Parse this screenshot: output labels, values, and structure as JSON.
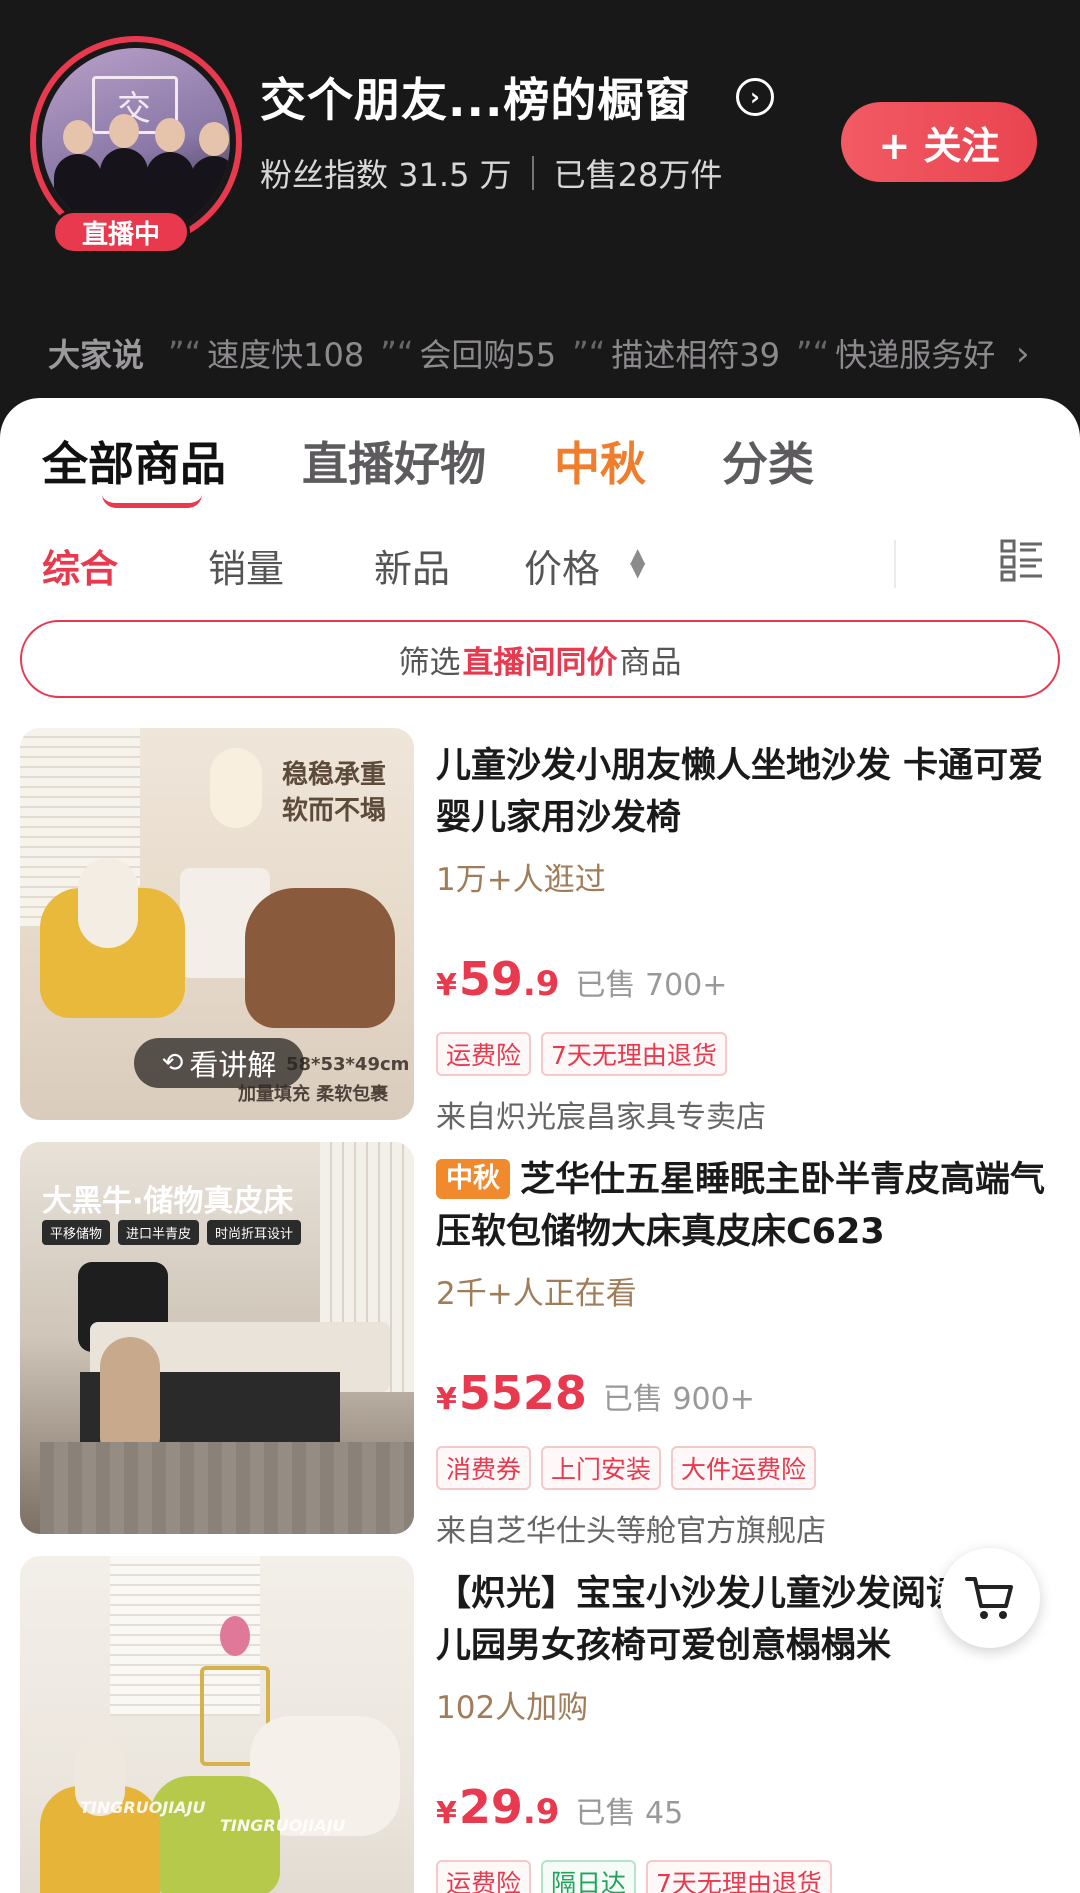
{
  "header": {
    "live_badge": "直播中",
    "shop_name": "交个朋友...榜的橱窗",
    "fans_text": "粉丝指数 31.5 万",
    "sold_text": "已售28万件",
    "follow_label": "+ 关注",
    "avatar_logo_text": "交"
  },
  "reviews": {
    "label": "大家说",
    "chips": [
      "速度快108",
      "会回购55",
      "描述相符39",
      "快递服务好"
    ]
  },
  "tabs": [
    "全部商品",
    "直播好物",
    "中秋",
    "分类"
  ],
  "sorts": [
    "综合",
    "销量",
    "新品",
    "价格"
  ],
  "filter": {
    "prefix": "筛选",
    "highlight": "直播间同价",
    "suffix": "商品"
  },
  "products": [
    {
      "title": "儿童沙发小朋友懒人坐地沙发 卡通可爱 婴儿家用沙发椅",
      "hot": "1万+人逛过",
      "currency": "¥",
      "price_int": "59",
      "price_dec": ".9",
      "sold": "已售 700+",
      "tags": [
        "运费险",
        "7天无理由退货"
      ],
      "store": "来自炽光宸昌家具专卖店",
      "img_text_1": "稳稳承重",
      "img_text_2": "软而不塌",
      "img_size": "58*53*49cm",
      "img_caption": "加量填充 柔软包裹",
      "watch_label": "看讲解"
    },
    {
      "title_tag": "中秋",
      "title": "芝华仕五星睡眠主卧半青皮高端气压软包储物大床真皮床C623",
      "hot": "2千+人正在看",
      "currency": "¥",
      "price_int": "5528",
      "price_dec": "",
      "sold": "已售 900+",
      "tags": [
        "消费券",
        "上门安装",
        "大件运费险"
      ],
      "store": "来自芝华仕头等舱官方旗舰店",
      "img_title": "大黑牛·储物真皮床",
      "img_badges": [
        "平移储物",
        "进口半青皮",
        "时尚折耳设计"
      ]
    },
    {
      "title": "【炽光】宝宝小沙发儿童沙发阅读角幼儿园男女孩椅可爱创意榻榻米",
      "hot": "102人加购",
      "currency": "¥",
      "price_int": "29",
      "price_dec": ".9",
      "sold": "已售 45",
      "tags": [
        "运费险",
        "隔日达",
        "7天无理由退货"
      ],
      "tag_colors": [
        "red",
        "green",
        "red"
      ],
      "watermark": "TINGRUOJIAJU"
    }
  ],
  "colors": {
    "accent": "#e8394f",
    "festival": "#ef7d2c",
    "header_bg": "#191819"
  }
}
